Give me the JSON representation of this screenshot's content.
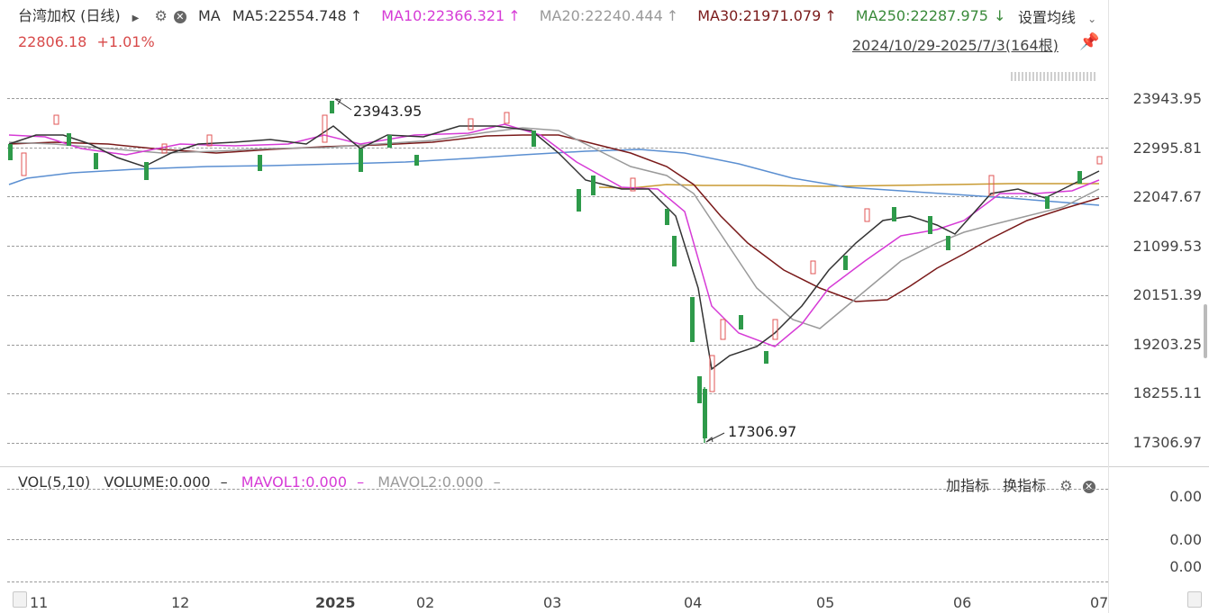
{
  "header": {
    "title": "台湾加权 (日线)",
    "indicator": "MA",
    "ma5": "MA5:22554.748",
    "ma10": "MA10:22366.321",
    "ma20": "MA20:22240.444",
    "ma30": "MA30:21971.079",
    "ma250": "MA250:22287.975",
    "price": "22806.18",
    "change": "+1.01%",
    "settings_label": "设置均线",
    "range_label": "2024/10/29-2025/7/3(164根)"
  },
  "colors": {
    "up": "#e05555",
    "down": "#2e9a4a",
    "ma5": "#333333",
    "ma10": "#d63bd6",
    "ma20": "#9a9a9a",
    "ma30": "#7a1a1a",
    "ma250": "#c89a32",
    "blue": "#5b8fd1"
  },
  "y_axis": [
    "23943.95",
    "22995.81",
    "22047.67",
    "21099.53",
    "20151.39",
    "19203.25",
    "18255.11",
    "17306.97"
  ],
  "annotations": {
    "high": "23943.95",
    "low": "17306.97"
  },
  "x_axis": [
    "11",
    "12",
    "2025",
    "02",
    "03",
    "04",
    "05",
    "06",
    "07"
  ],
  "volume": {
    "title": "VOL(5,10)",
    "vol": "VOLUME:0.000",
    "mavol1": "MAVOL1:0.000",
    "mavol2": "MAVOL2:0.000",
    "add_indicator": "加指标",
    "switch_indicator": "换指标",
    "y_axis": [
      "0.00",
      "0.00",
      "0.00"
    ]
  }
}
